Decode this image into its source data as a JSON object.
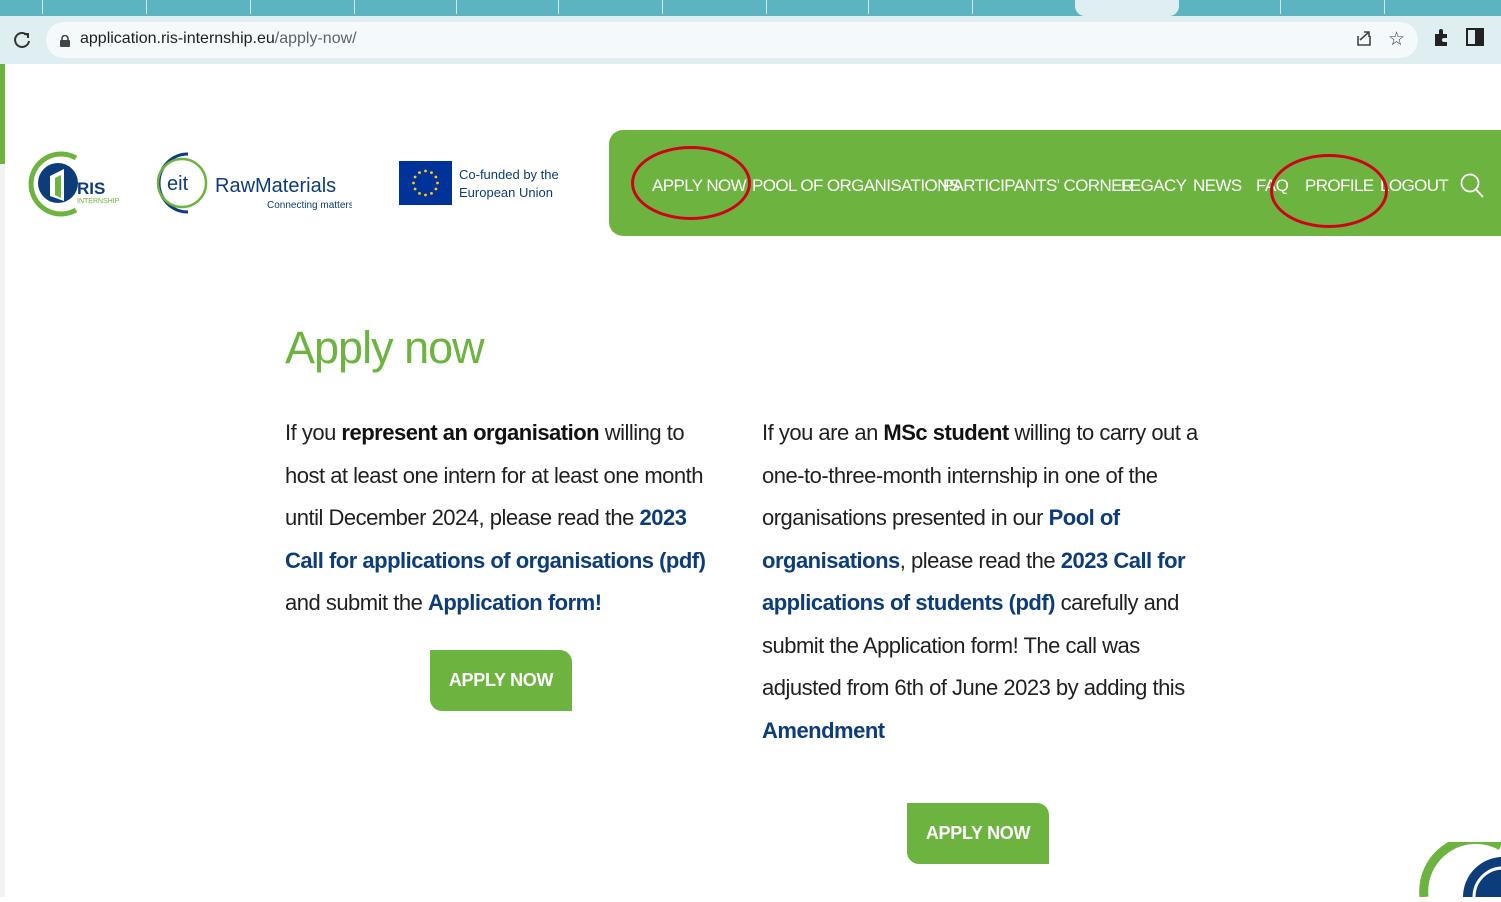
{
  "browser": {
    "url_host": "application.ris-internship.eu",
    "url_path": "/apply-now/"
  },
  "logos": {
    "ris": {
      "main": "RIS",
      "sub": "INTERNSHIP"
    },
    "eit": {
      "mark": "eit",
      "name": "RawMaterials",
      "tagline": "Connecting matters"
    },
    "eu": {
      "line1": "Co-funded by the",
      "line2": "European Union"
    }
  },
  "nav": {
    "items": [
      {
        "label": "APPLY NOW"
      },
      {
        "label": "POOL OF ORGANISATIONS"
      },
      {
        "label": "PARTICIPANTS' CORNER"
      },
      {
        "label": "LEGACY"
      },
      {
        "label": "NEWS"
      },
      {
        "label": "FAQ"
      },
      {
        "label": "PROFILE"
      },
      {
        "label": "LOGOUT"
      }
    ]
  },
  "main": {
    "title": "Apply now",
    "org": {
      "t1": "If you ",
      "b1": "represent an organisation",
      "t2": " willing to host at least one intern for at least one month until December 2024, please read the ",
      "l1": "2023 Call for applications of organisations (pdf)",
      "t3": " and submit the ",
      "l2": "Application form!",
      "button": "APPLY NOW"
    },
    "student": {
      "t1": "If you are an ",
      "b1": "MSc student",
      "t2": " willing to carry out a one-to-three-month internship in one of the organisations presented in our ",
      "l1": "Pool of organisations",
      "t3": ", please read the ",
      "l2": "2023 Call for applications of students (pdf)",
      "t4": " carefully and submit the Application form! The call was adjusted from 6th of June 2023 by adding this ",
      "l3": "Amendment",
      "button": "APPLY NOW"
    }
  },
  "colors": {
    "brand_green": "#6db33f",
    "link_blue": "#0d3c7a",
    "annotation_red": "#d0021b",
    "eu_blue": "#003399"
  }
}
